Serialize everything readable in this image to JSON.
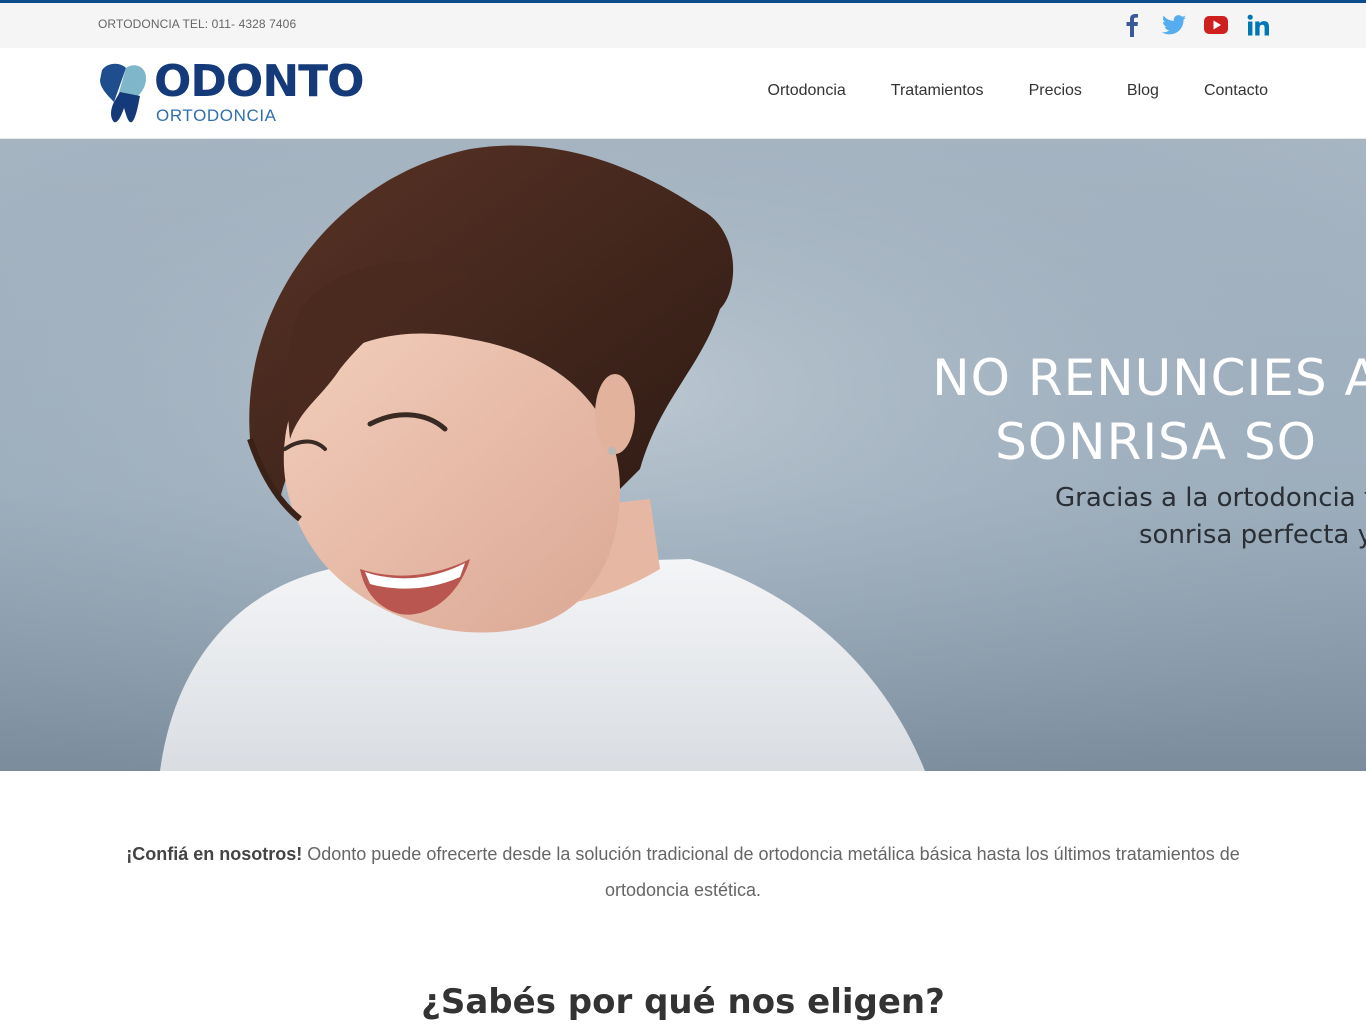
{
  "topbar": {
    "phone_text": "ORTODONCIA TEL: 011- 4328 7406",
    "social": [
      {
        "name": "facebook-icon",
        "color": "#3b5998"
      },
      {
        "name": "twitter-icon",
        "color": "#55acee"
      },
      {
        "name": "youtube-icon",
        "color": "#cd201f"
      },
      {
        "name": "linkedin-icon",
        "color": "#0077b5"
      }
    ]
  },
  "header": {
    "logo_word": "ODONTO",
    "logo_sub": "ORTODONCIA",
    "nav": [
      "Ortodoncia",
      "Tratamientos",
      "Precios",
      "Blog",
      "Contacto"
    ]
  },
  "hero": {
    "title_line1": "NO RENUNCIES A",
    "title_line2": "SONRISA SO",
    "subtitle_line1": "Gracias a la ortodoncia t",
    "subtitle_line2": "sonrisa perfecta y"
  },
  "intro": {
    "bold": "¡Confiá en nosotros!",
    "text": " Odonto puede ofrecerte desde la solución tradicional de ortodoncia metálica básica hasta los últimos tratamientos de ortodoncia estética."
  },
  "section": {
    "heading": "¿Sabés por qué nos eligen?"
  },
  "colors": {
    "brand_dark": "#143a7a",
    "brand_light": "#2f6fb0",
    "topline": "#0b4d8a"
  }
}
